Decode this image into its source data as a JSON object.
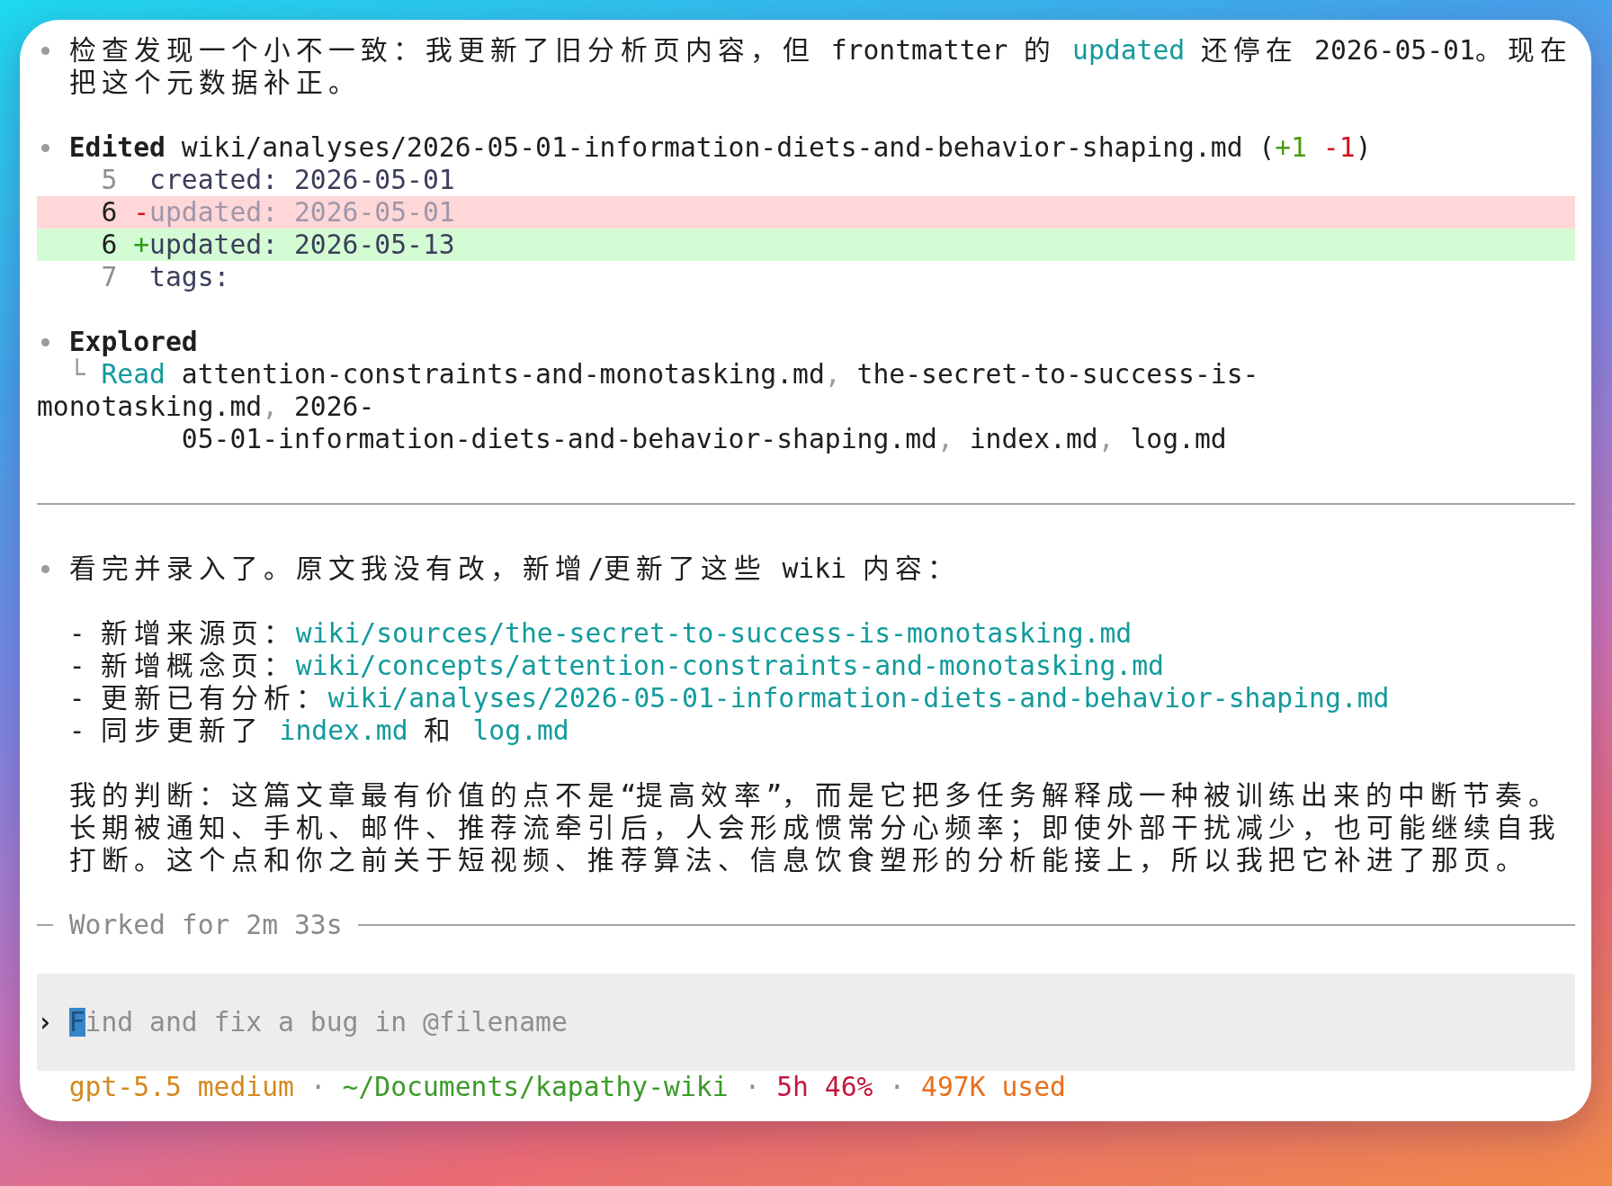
{
  "transcript": [
    {
      "kind": "message",
      "blocks": [
        {
          "kind": "paragraph",
          "segments": [
            {
              "text": "检查发现一个小不一致：我更新了旧分析页内容，但 frontmatter 的 ",
              "kind": "plain"
            },
            {
              "text": "updated",
              "kind": "code"
            },
            {
              "text": " 还停在 2026-05-01。现在把这个元数据补正。",
              "kind": "plain"
            }
          ]
        }
      ]
    },
    {
      "kind": "edit",
      "summary": [
        {
          "text": "Edited",
          "kind": "bold"
        },
        {
          "text": " wiki/analyses/2026-05-01-information-diets-and-behavior-shaping.md (",
          "kind": "plain"
        },
        {
          "text": "+1",
          "kind": "added"
        },
        {
          "text": " -1",
          "kind": "removed"
        },
        {
          "text": ")",
          "kind": "plain"
        }
      ],
      "lines": [
        {
          "number": "5",
          "kind": "context",
          "text": "created: 2026-05-01"
        },
        {
          "number": "6",
          "kind": "removed",
          "sign": "-",
          "text": "updated: 2026-05-01"
        },
        {
          "number": "6",
          "kind": "added",
          "sign": "+",
          "text": "updated: 2026-05-13"
        },
        {
          "number": "7",
          "kind": "context",
          "text": "tags:"
        }
      ]
    },
    {
      "kind": "explored",
      "label": "Explored",
      "entries": [
        {
          "branch": "└",
          "verb": "Read",
          "separator": ",",
          "files": [
            "attention-constraints-and-monotasking.md",
            "the-secret-to-success-is-\nmonotasking.md",
            "2026-\n         05-01-information-diets-and-behavior-shaping.md",
            "index.md",
            "log.md"
          ]
        }
      ]
    },
    {
      "kind": "rule"
    },
    {
      "kind": "message",
      "blocks": [
        {
          "kind": "paragraph",
          "segments": [
            {
              "text": "看完并录入了。原文我没有改，新增/更新了这些 wiki 内容：",
              "kind": "plain"
            }
          ]
        },
        {
          "kind": "list",
          "items": [
            {
              "marker": "-",
              "segments": [
                {
                  "text": "新增来源页：",
                  "kind": "plain"
                },
                {
                  "text": "wiki/sources/the-secret-to-success-is-monotasking.md",
                  "kind": "code"
                }
              ]
            },
            {
              "marker": "-",
              "segments": [
                {
                  "text": "新增概念页：",
                  "kind": "plain"
                },
                {
                  "text": "wiki/concepts/attention-constraints-and-monotasking.md",
                  "kind": "code"
                }
              ]
            },
            {
              "marker": "-",
              "segments": [
                {
                  "text": "更新已有分析：",
                  "kind": "plain"
                },
                {
                  "text": "wiki/analyses/2026-05-01-information-diets-and-behavior-shaping.md",
                  "kind": "code"
                }
              ]
            },
            {
              "marker": "-",
              "segments": [
                {
                  "text": "同步更新了 ",
                  "kind": "plain"
                },
                {
                  "text": "index.md",
                  "kind": "code"
                },
                {
                  "text": " 和 ",
                  "kind": "plain"
                },
                {
                  "text": "log.md",
                  "kind": "code"
                }
              ]
            }
          ]
        },
        {
          "kind": "paragraph",
          "segments": [
            {
              "text": "我的判断：这篇文章最有价值的点不是“提高效率”，而是它把多任务解释成一种被训练出来的中断节奏。长期被通知、手机、邮件、推荐流牵引后，人会形成惯常分心频率；即使外部干扰减少，也可能继续自我打断。这个点和你之前关于短视频、推荐算法、信息饮食塑形的分析能接上，所以我把它补进了那页。",
              "kind": "plain"
            }
          ]
        }
      ]
    }
  ],
  "worked": {
    "text": "Worked for 2m 33s"
  },
  "composer": {
    "prompt": "›",
    "placeholder": "Find and fix a bug in @filename"
  },
  "status_bar": {
    "separator": "·",
    "items": [
      {
        "text": "gpt-5.5 medium",
        "color": "#d4891e"
      },
      {
        "text": "~/Documents/kapathy-wiki",
        "color": "#3c9a2b"
      },
      {
        "text": "5h 46%",
        "color": "#c4163e"
      },
      {
        "text": "497K used",
        "color": "#e8701c"
      }
    ]
  }
}
